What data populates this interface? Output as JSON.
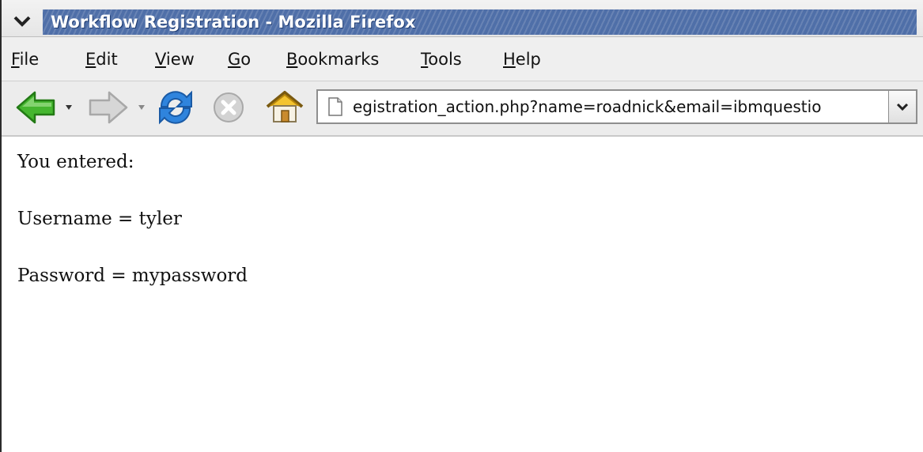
{
  "window": {
    "title": "Workflow Registration - Mozilla Firefox"
  },
  "menubar": {
    "items": [
      {
        "label": "File",
        "accel": "F",
        "rest": "ile"
      },
      {
        "label": "Edit",
        "accel": "E",
        "rest": "dit"
      },
      {
        "label": "View",
        "accel": "V",
        "rest": "iew"
      },
      {
        "label": "Go",
        "accel": "G",
        "rest": "o"
      },
      {
        "label": "Bookmarks",
        "accel": "B",
        "rest": "ookmarks"
      },
      {
        "label": "Tools",
        "accel": "T",
        "rest": "ools"
      },
      {
        "label": "Help",
        "accel": "H",
        "rest": "elp"
      }
    ]
  },
  "toolbar": {
    "icons": [
      "back-arrow-icon",
      "forward-arrow-icon",
      "reload-icon",
      "stop-icon",
      "home-icon"
    ],
    "url": "egistration_action.php?name=roadnick&email=ibmquestio"
  },
  "content": {
    "line1": "You entered:",
    "line2": "Username = tyler",
    "line3": "Password = mypassword"
  },
  "colors": {
    "title_bar": "#4f6fa8",
    "back_arrow": "#3fae2a",
    "reload": "#2f7fd8"
  }
}
